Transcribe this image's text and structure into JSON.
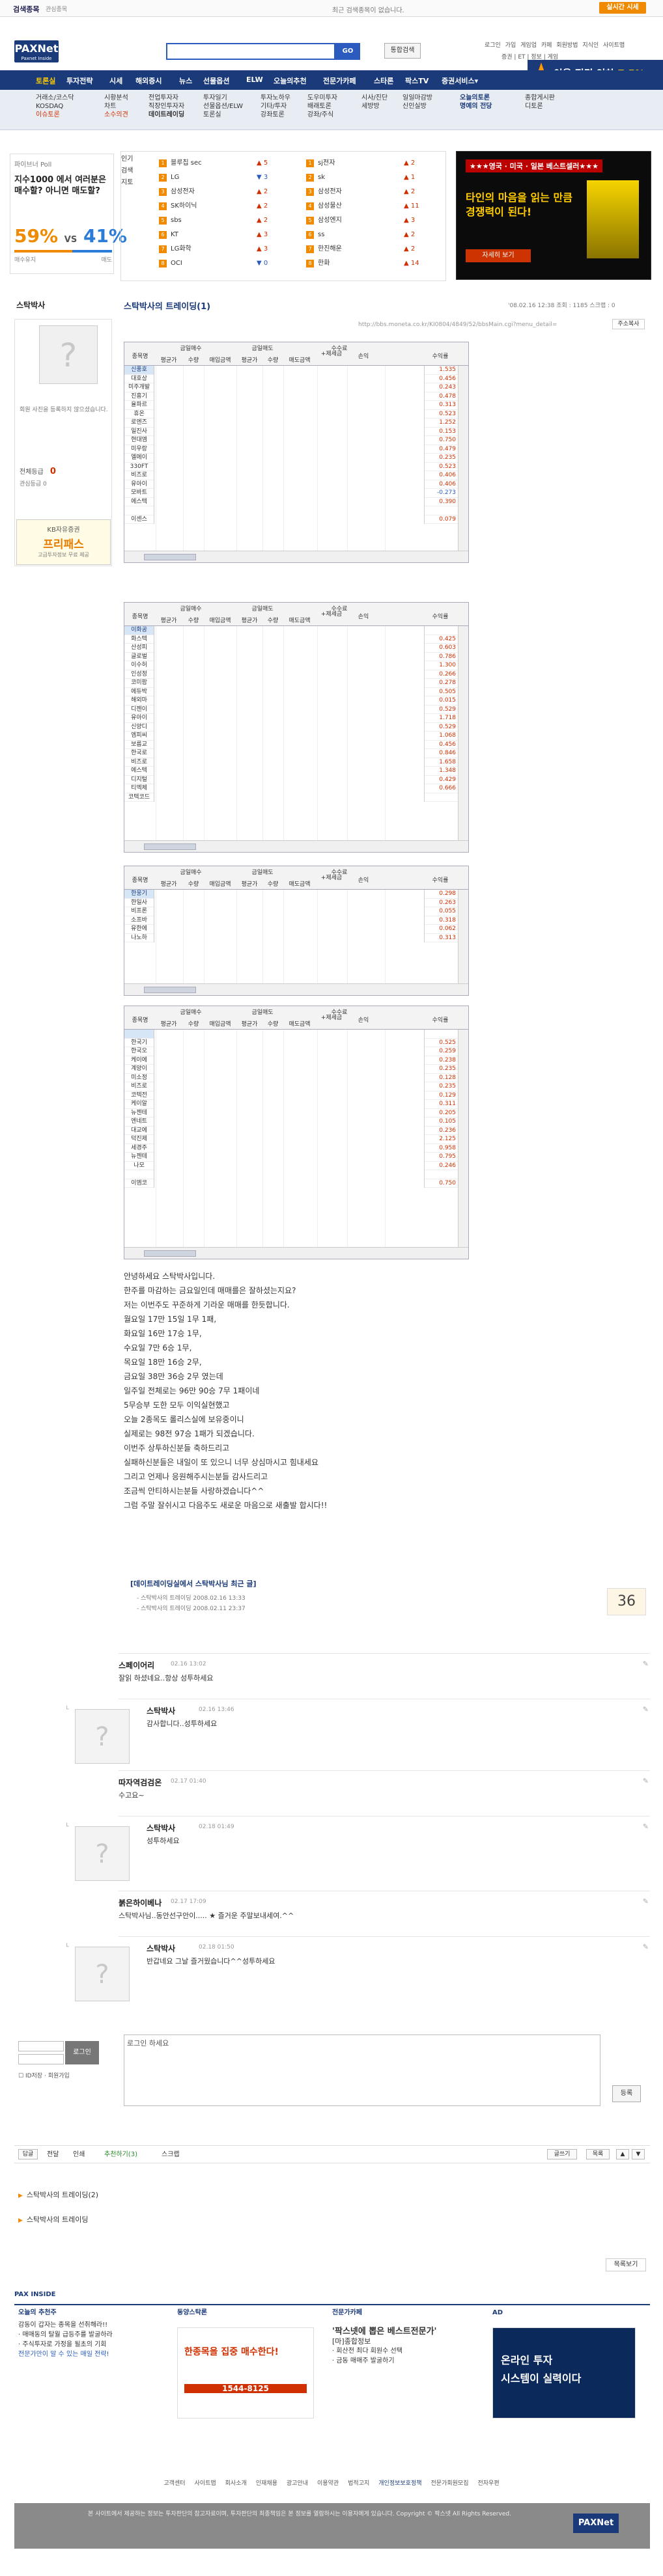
{
  "topbar": {
    "search_rank_label": "검색종목",
    "search_rank_sub": "관심종목",
    "rank_empty": "최근 검색종목이 없습니다.",
    "realtime_btn": "실시간 시세"
  },
  "header": {
    "logo": "PAXNet",
    "logo_sub": "Paxnet Inside",
    "search_go": "GO",
    "search_all": "통합검색",
    "util_links": [
      "로그인",
      "가입",
      "게임업",
      "카페",
      "회원방법",
      "지식인",
      "사이트맵"
    ],
    "util_links2": [
      "증권",
      "ET",
      "정보",
      "게임"
    ]
  },
  "nav": {
    "items": [
      "토론실",
      "투자전략",
      "시세",
      "해외증시",
      "뉴스",
      "선물옵션",
      "ELW",
      "오늘의추천",
      "전문가카페",
      "스타론",
      "팍스TV",
      "증권서비스▾"
    ]
  },
  "promo": {
    "text": "이율 전격 인하",
    "pct": "7.5%"
  },
  "subnav": {
    "cols": [
      [
        "거래소/코스닥",
        "KOSDAQ",
        "이슈토론"
      ],
      [
        "시황분석",
        "차트",
        "소수의견"
      ],
      [
        "전업투자자",
        "직장인투자자",
        "데이트레이딩"
      ],
      [
        "투자일기",
        "선물옵션/ELW",
        "토론실"
      ],
      [
        "투자노하우",
        "기타/투자",
        "강좌토론"
      ],
      [
        "도우미투자",
        "배래토론",
        "강좌/주식"
      ],
      [
        "시사/진단",
        "세방방",
        ""
      ],
      [
        "일일마감방",
        "신인실방",
        ""
      ],
      [
        "오늘의토론",
        "명예의 전당",
        ""
      ],
      [
        "종합게시판",
        "디토론",
        ""
      ]
    ]
  },
  "poll": {
    "title": "파이브너 Poll",
    "question": "지수1000 에서 여러분은 매수할? 아니면 매도할?",
    "buy_pct": "59%",
    "vs": "VS",
    "sell_pct": "41%",
    "buy_fraction": 0.59,
    "buy_label": "매수유지",
    "sell_label": "매도"
  },
  "rank": {
    "tabs": [
      "인기",
      "검색",
      "지토"
    ],
    "left": [
      {
        "name": "블루칩 sec",
        "chg": "▲ 5",
        "dir": "up"
      },
      {
        "name": "LG",
        "chg": "▼ 3",
        "dir": "down"
      },
      {
        "name": "삼성전자",
        "chg": "▲ 2",
        "dir": "up"
      },
      {
        "name": "SK하이닉",
        "chg": "▲ 2",
        "dir": "up"
      },
      {
        "name": "sbs",
        "chg": "▲ 2",
        "dir": "up"
      },
      {
        "name": "KT",
        "chg": "▲ 3",
        "dir": "up"
      },
      {
        "name": "LG화학",
        "chg": "▲ 3",
        "dir": "up"
      },
      {
        "name": "OCI",
        "chg": "▼ 0",
        "dir": "down"
      }
    ],
    "right": [
      {
        "name": "sj전자",
        "chg": "▲ 2",
        "dir": "up"
      },
      {
        "name": "sk",
        "chg": "▲ 1",
        "dir": "up"
      },
      {
        "name": "삼성전자",
        "chg": "▲ 2",
        "dir": "up"
      },
      {
        "name": "삼성물산",
        "chg": "▲ 11",
        "dir": "up"
      },
      {
        "name": "삼성엔지",
        "chg": "▲ 3",
        "dir": "up"
      },
      {
        "name": "ss",
        "chg": "▲ 2",
        "dir": "up"
      },
      {
        "name": "한진해운",
        "chg": "▲ 2",
        "dir": "up"
      },
      {
        "name": "한화",
        "chg": "▲ 14",
        "dir": "up"
      }
    ]
  },
  "ad_banner": {
    "tag": "★★★영국 · 미국 · 일본 베스트셀러★★★",
    "headline": "타인의 마음을 읽는 만큼 경쟁력이 된다!",
    "cta": "자세히 보기"
  },
  "profile": {
    "name": "스탁박사",
    "note": "회원 사진을 등록하지 않으셨습니다.",
    "grade_label": "전체등급",
    "grade_value": "0",
    "fav_label": "관심등급 0"
  },
  "kb_ad": {
    "line1": "KB자유증권",
    "line2": "프리패스",
    "line3": "고급투자정보 무료 제공"
  },
  "post": {
    "title": "스탁박사의 트레이딩(1)",
    "meta": "'08.02.16 12:38   조회 : 1185   스크랩 : 0",
    "url": "http://bbs.moneta.co.kr/KI0804/4849/52/bbsMain.cgi?menu_detail=",
    "copy": "주소복사"
  },
  "panel_head": {
    "code": "종목명",
    "buy_group": "금일매수",
    "sell_group": "금일매도",
    "profit_group": "수수료",
    "avg_price": "평균가",
    "qty": "수량",
    "amount": "매입금액",
    "sell_amount": "매도금액",
    "fee": "+제세금",
    "pnl": "손익",
    "pct": "수익률"
  },
  "panels": [
    {
      "codes": [
        "신풍호",
        "대호상",
        "미주개발",
        "진흥기",
        "율파르",
        "휴온",
        "로엔즈",
        "일진사",
        "현대엠",
        "미우랑",
        "엘에이",
        "330FT",
        "비즈로",
        "유아이",
        "모바트",
        "에스텍",
        "",
        "이센스"
      ],
      "pcts": [
        "1.535",
        "0.456",
        "0.243",
        "0.478",
        "0.313",
        "0.523",
        "1.252",
        "0.153",
        "0.750",
        "0.479",
        "0.235",
        "0.523",
        "0.406",
        "0.406",
        "-0.273",
        "0.390",
        "",
        "0.079"
      ]
    },
    {
      "codes": [
        "이화공",
        "화스텍",
        "산성피",
        "글로벌",
        "이수허",
        "인성정",
        "코미팜",
        "에듀박",
        "해외마",
        "디젠이",
        "유아이",
        "신양디",
        "엠피씨",
        "보름교",
        "한국로",
        "비즈로",
        "에스텍",
        "디지털",
        "티엑체",
        "코텍코드"
      ],
      "pcts": [
        "",
        "0.425",
        "0.603",
        "0.786",
        "1.300",
        "0.266",
        "0.278",
        "0.505",
        "0.015",
        "0.529",
        "1.718",
        "0.529",
        "1.068",
        "0.456",
        "0.846",
        "1.658",
        "1.348",
        "0.429",
        "0.666",
        ""
      ]
    },
    {
      "codes": [
        "한웅기",
        "한일사",
        "비프론",
        "소프바",
        "유한에",
        "나노하"
      ],
      "pcts": [
        "0.298",
        "0.263",
        "0.055",
        "0.318",
        "0.062",
        "0.313"
      ]
    },
    {
      "codes": [
        "",
        "한국기",
        "한국오",
        "케이에",
        "계양이",
        "미소정",
        "비즈로",
        "코텍전",
        "케이알",
        "뉴젠테",
        "엔네트",
        "대교에",
        "덕진제",
        "세경주",
        "뉴젠테",
        "나모",
        "",
        "이엠코"
      ],
      "pcts": [
        "",
        "0.525",
        "0.259",
        "0.238",
        "0.235",
        "0.128",
        "0.235",
        "0.129",
        "0.311",
        "0.205",
        "0.105",
        "0.236",
        "2.125",
        "0.958",
        "0.795",
        "0.246",
        "",
        "0.750"
      ]
    }
  ],
  "post_body": [
    "안녕하세요 스탁박사입니다.",
    "한주를 마감하는 금요일인데 매매를은 잘하셨는지요?",
    "저는 이번주도 꾸준하게 기라운 매매를 한듯합니다.",
    "월요일 17만 15일 1무 1패,",
    "화요일 16만 17승 1무,",
    "수요일 7만 6승 1무,",
    "목요일 18만 16승 2무,",
    "금요일 38만 36승 2무 였는데",
    "일주일 전체로는 96만 90승 7무 1패이네",
    "5무승부 도한 모두 이익실현했고",
    "오늘 2종목도 롤리스실에 보유중이니",
    "실제로는 98전 97승 1패가 되겠습니다.",
    "이번주 상투하신분들 축하드리고",
    "실패하신분들은 내일이 또 있으니 너무 상심마시고 힘내세요",
    "그리고 언제나 응원해주시는분들 감사드리고",
    "조금씩 안티하시는분들 사랑하겠습니다^^",
    "그럼 주말 잘쉬시고 다음주도 새로운 마음으로 새출발 합시다!!"
  ],
  "related": {
    "title": "[데이트레이딩실에서 스탁박사님 최근 글]",
    "lines": [
      "- 스탁박사의 트레이딩   2008.02.16 13:33",
      "- 스탁박사의 트레이딩   2008.02.11 23:37"
    ],
    "rec_count": "36"
  },
  "comments": [
    {
      "name": "스페이어리",
      "date": "02.16 13:02",
      "text": "잘읽 하셨네요..항상 성투하세요"
    },
    {
      "name": "스탁박사",
      "date": "02.16 13:46",
      "text": "감사합니다..성투하세요"
    },
    {
      "name": "따자역검검온",
      "date": "02.17 01:40",
      "text": "수고요~"
    },
    {
      "name": "스탁박사",
      "date": "02.18 01:49",
      "text": "성투하세요"
    },
    {
      "name": "붉은하이베나",
      "date": "02.17 17:09",
      "text": "스탁박사님..동안선구안이..... ★ 즐거운 주말보내세여.^^"
    },
    {
      "name": "스탁박사",
      "date": "02.18 01:50",
      "text": "반갑네요 그날 즐거웠습니다^^성투하세요"
    }
  ],
  "comment_form": {
    "login_btn": "로그인",
    "input_placeholder": "로그인 하세요",
    "submit": "등록",
    "remember": "ID저장",
    "join": "회원가입"
  },
  "action_bar": {
    "items": [
      "답글",
      "전달",
      "인쇄",
      "추천하기(3)",
      "스크랩"
    ],
    "prev": "글쓰기",
    "next": "목록",
    "up": "▲",
    "down": "▼"
  },
  "bottom_links": [
    "스탁박사의 트레이딩(2)",
    "스탁박사의 트레이딩"
  ],
  "list_btn": "목록보기",
  "inside": {
    "title": "PAX INSIDE",
    "col1_title": "오늘의 추천주",
    "col1": [
      "감동이 갑자는 종목을 선취해라!!",
      "· 매매동의 탈월 급등주를 발굴하라",
      "· 주식투자로 가정을 될초의 기회",
      "전문가만이 알 수 있는 매일 전략!"
    ],
    "col2_title": "동양스탁론",
    "col2": [
      "한종목을 집중 매수한다!",
      "1544-8125"
    ],
    "col3_title": "전문가카페",
    "col3": [
      "'팍스넷에 뽑은 베스트전문가'",
      "[마]종합정보",
      "· 회산전 최다 회원수 선택",
      "· 금동 매매주 발굴하기"
    ],
    "col4_title": "AD",
    "col4": [
      "온라인 투자",
      "시스템이 실력이다"
    ]
  },
  "footer": {
    "links": [
      "고객센터",
      "사이트맵",
      "회사소개",
      "인재채용",
      "광고안내",
      "이용약관",
      "법적고지",
      "개인정보보호정책",
      "전문가회원모집",
      "전자우편"
    ],
    "text": "본 사이트에서 제공하는 정보는 투자판단의 참고자료이며, 투자판단의 최종책임은 본 정보를 열람하시는 이용자에게 있습니다. Copyright © 팍스넷 All Rights Reserved.",
    "logo": "PAXNet"
  }
}
